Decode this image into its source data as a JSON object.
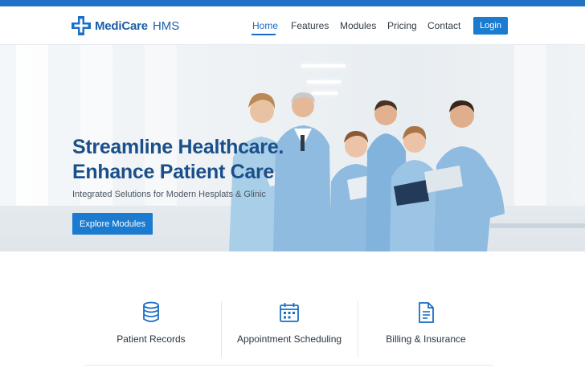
{
  "brand": {
    "name": "MediCare",
    "suffix": "HMS",
    "icon": "medical-cross-icon",
    "accent": "#1a7bd1"
  },
  "nav": {
    "items": [
      {
        "label": "Home",
        "active": true
      },
      {
        "label": "Features",
        "active": false
      },
      {
        "label": "Modules",
        "active": false
      },
      {
        "label": "Pricing",
        "active": false
      },
      {
        "label": "Contact",
        "active": false
      }
    ],
    "login_label": "Login"
  },
  "hero": {
    "title_line1": "Streamline Healthcare.",
    "title_line2": "Enhance Patient Care",
    "subtitle": "Integrated Selutions for Modern Hesplats & Glinic",
    "cta_label": "Explore Modules"
  },
  "features": [
    {
      "label": "Patient Records",
      "icon": "database-icon"
    },
    {
      "label": "Appointment Scheduling",
      "icon": "calendar-icon"
    },
    {
      "label": "Billing & Insurance",
      "icon": "document-icon"
    }
  ]
}
